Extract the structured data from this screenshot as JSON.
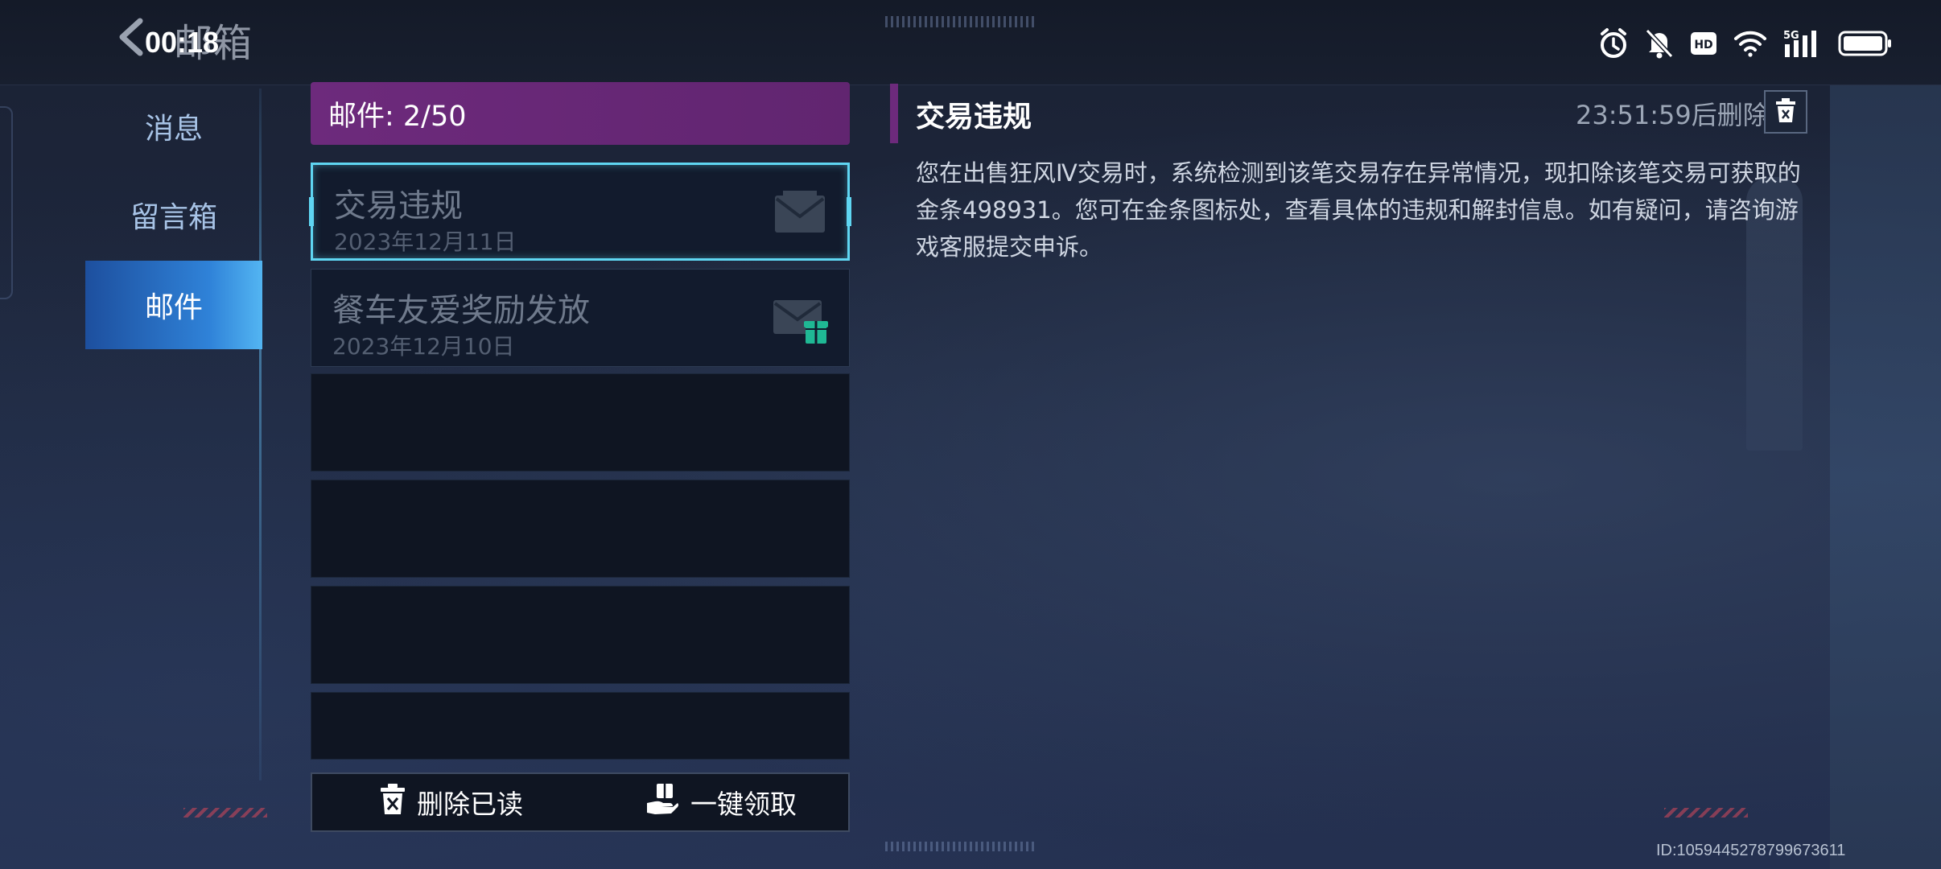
{
  "status_bar": {
    "time": "00:18",
    "icons": [
      "alarm-icon",
      "notifications-muted-icon",
      "hd-icon",
      "wifi-icon",
      "5g-signal-icon",
      "battery-icon"
    ],
    "hd_label": "HD",
    "network_label": "5G"
  },
  "header": {
    "title": "邮箱",
    "back_icon": "chevron-left-icon"
  },
  "nav": {
    "items": [
      {
        "label": "消息",
        "active": false
      },
      {
        "label": "留言箱",
        "active": false
      },
      {
        "label": "邮件",
        "active": true
      }
    ]
  },
  "mail_list": {
    "count_label": "邮件: 2/50",
    "items": [
      {
        "subject": "交易违规",
        "date": "2023年12月11日",
        "icon": "envelope-icon",
        "selected": true
      },
      {
        "subject": "餐车友爱奖励发放",
        "date": "2023年12月10日",
        "icon": "envelope-gift-icon",
        "selected": false
      }
    ],
    "empty_slots": 4
  },
  "actions": {
    "delete_read": "删除已读",
    "claim_all": "一键领取"
  },
  "detail": {
    "title": "交易违规",
    "timer": "23:51:59后删除",
    "body": "您在出售狂风Ⅳ交易时，系统检测到该笔交易存在异常情况，现扣除该笔交易可获取的金条498931。您可在金条图标处，查看具体的违规和解封信息。如有疑问，请咨询游戏客服提交申诉。"
  },
  "footer": {
    "id_text": "ID:1059445278799673611"
  },
  "colors": {
    "accent_purple": "#6d2a7c",
    "accent_cyan": "#5fd6f2",
    "nav_active": "#2f82d8",
    "gift_green": "#1fb894"
  }
}
